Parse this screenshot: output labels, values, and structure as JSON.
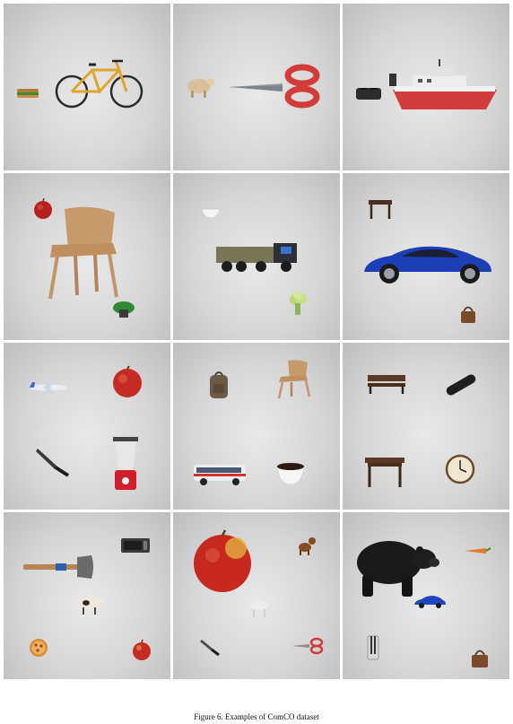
{
  "caption": "Figure 6. Examples of ComCO dataset",
  "scenes": [
    {
      "objects": [
        "sandwich",
        "bicycle"
      ]
    },
    {
      "objects": [
        "sheep",
        "scissors"
      ]
    },
    {
      "objects": [
        "toaster",
        "boat"
      ]
    },
    {
      "objects": [
        "apple",
        "chair",
        "potted-plant"
      ]
    },
    {
      "objects": [
        "cup",
        "truck",
        "broccoli"
      ]
    },
    {
      "objects": [
        "dining-table",
        "car",
        "handbag"
      ]
    },
    {
      "objects": [
        "airplane",
        "apple",
        "knife",
        "blender"
      ]
    },
    {
      "objects": [
        "backpack",
        "chair",
        "bus",
        "cup"
      ]
    },
    {
      "objects": [
        "bench",
        "skateboard",
        "dining-table",
        "clock"
      ]
    },
    {
      "objects": [
        "axe",
        "microwave",
        "cow",
        "pizza",
        "apple"
      ]
    },
    {
      "objects": [
        "apple",
        "dog",
        "horse",
        "knife",
        "scissors"
      ]
    },
    {
      "objects": [
        "bear",
        "carrot",
        "car",
        "toaster",
        "handbag"
      ]
    }
  ]
}
